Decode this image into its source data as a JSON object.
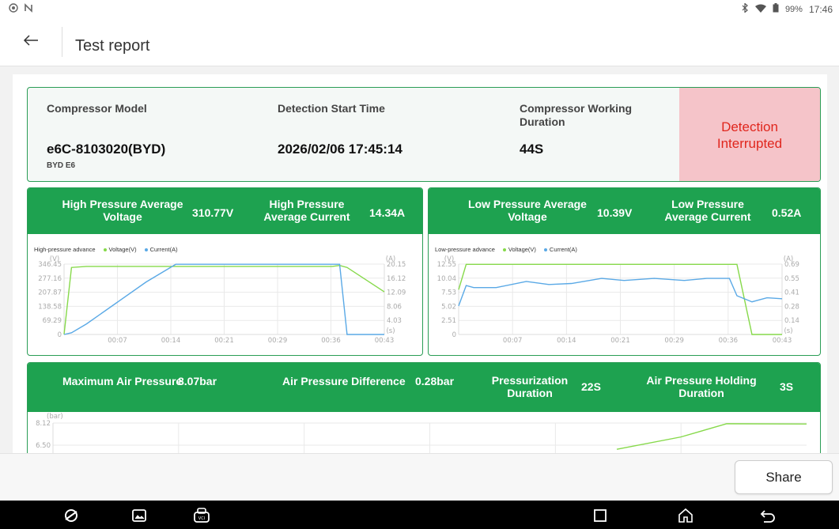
{
  "status_bar": {
    "battery": "99%",
    "time": "17:46"
  },
  "header": {
    "title": "Test report"
  },
  "info": {
    "compressor_model_label": "Compressor Model",
    "compressor_model_value": "e6C-8103020(BYD)",
    "vehicle": "BYD E6",
    "start_time_label": "Detection Start Time",
    "start_time_value": "2026/02/06 17:45:14",
    "duration_label": "Compressor Working Duration",
    "duration_value": "44S",
    "status": "Detection Interrupted",
    "status_colors": {
      "background": "#f5c4c9",
      "text": "#e0261d"
    }
  },
  "high_pressure": {
    "avg_voltage_label": "High Pressure Average Voltage",
    "avg_voltage_value": "310.77V",
    "avg_current_label": "High Pressure Average Current",
    "avg_current_value": "14.34A",
    "legend_title": "High-pressure advance",
    "legend_voltage": "Voltage(V)",
    "legend_current": "Current(A)",
    "left_unit": "(V)",
    "right_unit": "(A)",
    "x_unit": "(s)",
    "left_ticks": [
      "346.45",
      "277.16",
      "207.87",
      "138.58",
      "69.29",
      "0"
    ],
    "right_ticks": [
      "20.15",
      "16.12",
      "12.09",
      "8.06",
      "4.03"
    ],
    "x_ticks": [
      "00:07",
      "00:14",
      "00:21",
      "00:29",
      "00:36",
      "00:43"
    ]
  },
  "low_pressure": {
    "avg_voltage_label": "Low Pressure Average Voltage",
    "avg_voltage_value": "10.39V",
    "avg_current_label": "Low Pressure Average Current",
    "avg_current_value": "0.52A",
    "legend_title": "Low-pressure advance",
    "legend_voltage": "Voltage(V)",
    "legend_current": "Current(A)",
    "left_unit": "(V)",
    "right_unit": "(A)",
    "x_unit": "(s)",
    "left_ticks": [
      "12.55",
      "10.04",
      "7.53",
      "5.02",
      "2.51",
      "0"
    ],
    "right_ticks": [
      "0.69",
      "0.55",
      "0.41",
      "0.28",
      "0.14"
    ],
    "x_ticks": [
      "00:07",
      "00:14",
      "00:21",
      "00:29",
      "00:36",
      "00:43"
    ]
  },
  "air": {
    "max_pressure_label": "Maximum Air Pressure",
    "max_pressure_value": "8.07bar",
    "difference_label": "Air Pressure Difference",
    "difference_value": "0.28bar",
    "pressurization_label": "Pressurization Duration",
    "pressurization_value": "22S",
    "holding_label": "Air Pressure Holding Duration",
    "holding_value": "3S",
    "unit": "(bar)",
    "y_ticks": [
      "8.12",
      "6.50"
    ]
  },
  "footer": {
    "share_label": "Share"
  },
  "colors": {
    "brand_green": "#1ea250",
    "border_green": "#2a9d55",
    "voltage_line": "#86d94a",
    "current_line": "#5aa9e6"
  },
  "chart_data": [
    {
      "type": "line",
      "title": "High-pressure advance",
      "x": [
        0,
        1,
        3,
        7,
        11,
        15,
        21,
        29,
        36,
        37,
        38,
        43
      ],
      "series": [
        {
          "name": "Voltage(V)",
          "axis": "left",
          "values": [
            0,
            330,
            335,
            335,
            335,
            335,
            335,
            335,
            335,
            340,
            330,
            210
          ]
        },
        {
          "name": "Current(A)",
          "axis": "right",
          "values": [
            0,
            0.5,
            3,
            9,
            15,
            20.1,
            20.1,
            20.1,
            20.1,
            20.1,
            0,
            0
          ]
        }
      ],
      "ylim_left": [
        0,
        346.45
      ],
      "ylim_right": [
        0,
        20.15
      ],
      "xlim": [
        0,
        43
      ]
    },
    {
      "type": "line",
      "title": "Low-pressure advance",
      "x": [
        0,
        1,
        2,
        5,
        9,
        12,
        15,
        19,
        22,
        26,
        30,
        33,
        36,
        37,
        39,
        41,
        43
      ],
      "series": [
        {
          "name": "Voltage(V)",
          "axis": "left",
          "values": [
            8,
            12.5,
            12.5,
            12.5,
            12.5,
            12.5,
            12.5,
            12.5,
            12.5,
            12.5,
            12.5,
            12.5,
            12.5,
            12.5,
            0,
            0,
            0
          ]
        },
        {
          "name": "Current(A)",
          "axis": "right",
          "values": [
            0.28,
            0.48,
            0.46,
            0.46,
            0.52,
            0.49,
            0.5,
            0.55,
            0.53,
            0.55,
            0.53,
            0.55,
            0.55,
            0.38,
            0.32,
            0.36,
            0.35
          ]
        }
      ],
      "ylim_left": [
        0,
        12.55
      ],
      "ylim_right": [
        0,
        0.69
      ],
      "xlim": [
        0,
        43
      ]
    },
    {
      "type": "line",
      "title": "",
      "series": [
        {
          "name": "",
          "values": [
            6.2,
            7.1,
            8.07,
            8.05
          ]
        }
      ],
      "ylim": [
        6.5,
        8.12
      ]
    }
  ]
}
